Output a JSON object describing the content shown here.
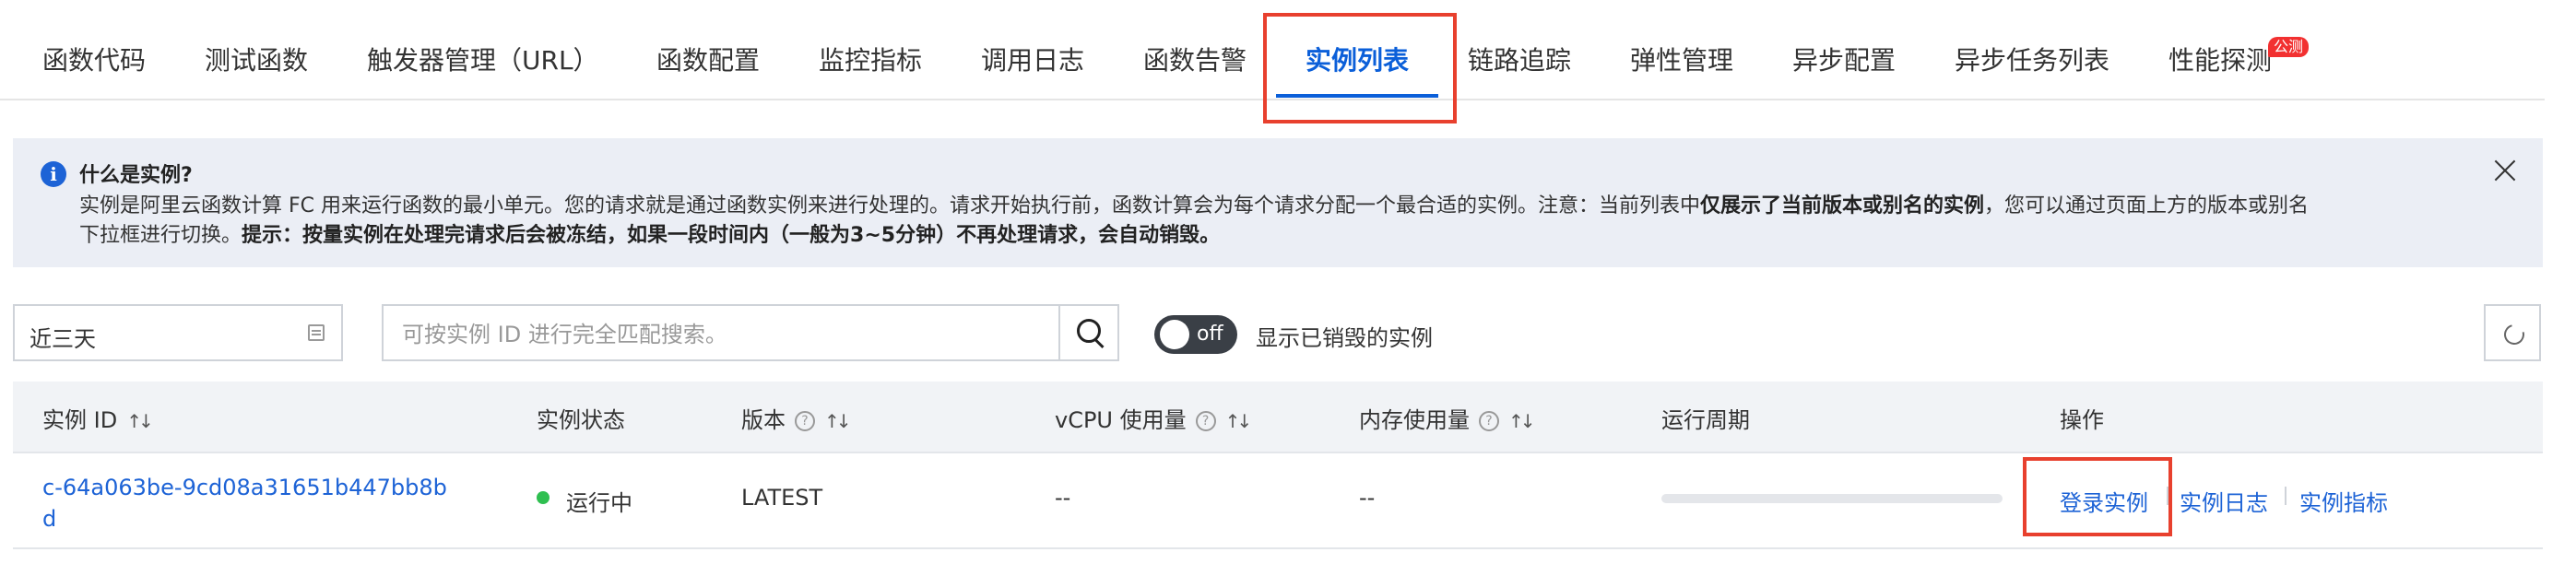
{
  "tabs": [
    {
      "label": "函数代码"
    },
    {
      "label": "测试函数"
    },
    {
      "label": "触发器管理（URL）"
    },
    {
      "label": "函数配置"
    },
    {
      "label": "监控指标"
    },
    {
      "label": "调用日志"
    },
    {
      "label": "函数告警"
    },
    {
      "label": "实例列表",
      "active": true
    },
    {
      "label": "链路追踪"
    },
    {
      "label": "弹性管理"
    },
    {
      "label": "异步配置"
    },
    {
      "label": "异步任务列表"
    },
    {
      "label": "性能探测",
      "badge": "公测"
    }
  ],
  "banner": {
    "title": "什么是实例?",
    "line1_a": "实例是阿里云函数计算 FC 用来运行函数的最小单元。您的请求就是通过函数实例来进行处理的。请求开始执行前，函数计算会为每个请求分配一个最合适的实例。注意：当前列表中",
    "line1_bold": "仅展示了当前版本或别名的实例",
    "line1_b": "，您可以通过页面上方的版本或别名",
    "line2_a": "下拉框进行切换。",
    "line2_bold": "提示：按量实例在处理完请求后会被冻结，如果一段时间内（一般为3~5分钟）不再处理请求，会自动销毁。",
    "info_icon": "info-icon",
    "close_icon": "close-icon"
  },
  "toolbar": {
    "date_range": "近三天",
    "search_placeholder": "可按实例 ID 进行完全匹配搜索。",
    "toggle_label": "off",
    "toggle_on": false,
    "toggle_text": "显示已销毁的实例"
  },
  "table": {
    "headers": {
      "instance_id": "实例 ID",
      "status": "实例状态",
      "version": "版本",
      "vcpu": "vCPU 使用量",
      "memory": "内存使用量",
      "period": "运行周期",
      "actions": "操作"
    },
    "rows": [
      {
        "instance_id": "c-64a063be-9cd08a31651b447bb8bd",
        "status": "运行中",
        "version": "LATEST",
        "vcpu": "--",
        "memory": "--",
        "period_progress": 0.0,
        "actions": {
          "login": "登录实例",
          "logs": "实例日志",
          "metrics": "实例指标"
        }
      }
    ]
  },
  "colors": {
    "accent": "#0b5fd9",
    "running": "#2fbf50",
    "highlight_box": "#e8402e",
    "badge": "#f23030"
  }
}
